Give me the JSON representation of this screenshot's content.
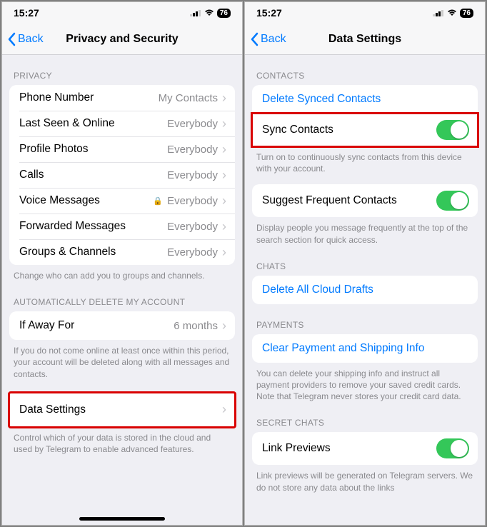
{
  "status": {
    "time": "15:27",
    "battery": "76"
  },
  "nav_back": "Back",
  "left": {
    "title": "Privacy and Security",
    "s_privacy": "Privacy",
    "rows": {
      "phone": {
        "label": "Phone Number",
        "value": "My Contacts"
      },
      "lastseen": {
        "label": "Last Seen & Online",
        "value": "Everybody"
      },
      "photos": {
        "label": "Profile Photos",
        "value": "Everybody"
      },
      "calls": {
        "label": "Calls",
        "value": "Everybody"
      },
      "voice": {
        "label": "Voice Messages",
        "value": "Everybody"
      },
      "fwd": {
        "label": "Forwarded Messages",
        "value": "Everybody"
      },
      "groups": {
        "label": "Groups & Channels",
        "value": "Everybody"
      }
    },
    "note_privacy": "Change who can add you to groups and channels.",
    "s_autodelete": "Automatically Delete My Account",
    "away": {
      "label": "If Away For",
      "value": "6 months"
    },
    "note_auto": "If you do not come online at least once within this period, your account will be deleted along with all messages and contacts.",
    "data_settings": "Data Settings",
    "note_data": "Control which of your data is stored in the cloud and used by Telegram to enable advanced features."
  },
  "right": {
    "title": "Data Settings",
    "s_contacts": "Contacts",
    "delete_synced": "Delete Synced Contacts",
    "sync_contacts": "Sync Contacts",
    "note_sync": "Turn on to continuously sync contacts from this device with your account.",
    "suggest": "Suggest Frequent Contacts",
    "note_suggest": "Display people you message frequently at the top of the search section for quick access.",
    "s_chats": "Chats",
    "delete_drafts": "Delete All Cloud Drafts",
    "s_payments": "Payments",
    "clear_payment": "Clear Payment and Shipping Info",
    "note_payment": "You can delete your shipping info and instruct all payment providers to remove your saved credit cards. Note that Telegram never stores your credit card data.",
    "s_secret": "Secret Chats",
    "link_previews": "Link Previews",
    "note_link": "Link previews will be generated on Telegram servers. We do not store any data about the links"
  }
}
